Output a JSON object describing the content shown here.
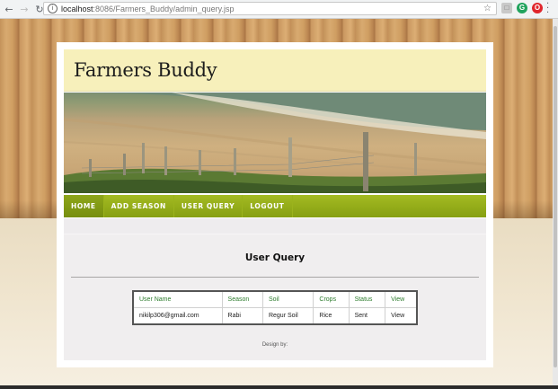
{
  "browser": {
    "url_host": "localhost",
    "url_path": ":8086/Farmers_Buddy/admin_query.jsp",
    "back_icon": "arrow-left-icon",
    "forward_icon": "arrow-right-icon",
    "reload_icon": "reload-icon",
    "extension_1_icon": "extension-grey-icon",
    "extension_2_icon": "extension-green-icon",
    "extension_3_icon": "opera-icon"
  },
  "site": {
    "title": "Farmers Buddy"
  },
  "nav": {
    "items": [
      {
        "label": "HOME",
        "active": true
      },
      {
        "label": "ADD SEASON",
        "active": false
      },
      {
        "label": "USER QUERY",
        "active": false
      },
      {
        "label": "LOGOUT",
        "active": false
      }
    ]
  },
  "main": {
    "heading": "User Query",
    "table": {
      "headers": [
        "User Name",
        "Season",
        "Soil",
        "Crops",
        "Status",
        "View"
      ],
      "rows": [
        [
          "nikilp306@gmail.com",
          "Rabi",
          "Regur Soil",
          "Rice",
          "Sent",
          "View"
        ]
      ]
    }
  },
  "footer": {
    "text": "Design by:"
  },
  "colors": {
    "nav_green": "#96ae1a",
    "header_yellow": "#f7f0bb",
    "table_header_green": "#2e7d2e"
  }
}
